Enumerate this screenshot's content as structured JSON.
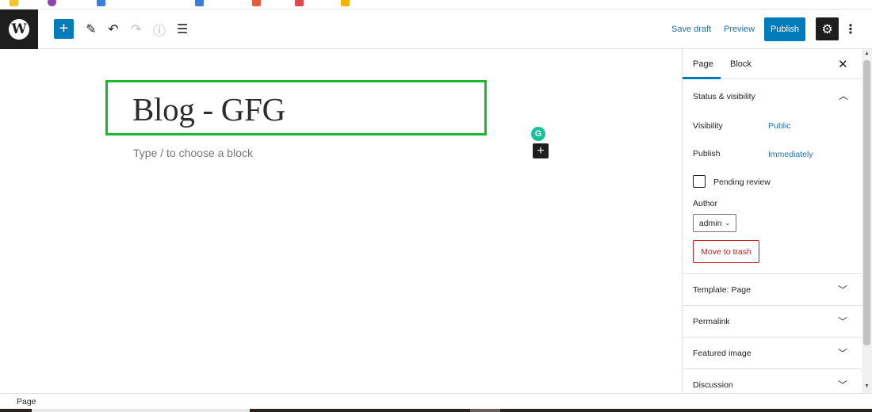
{
  "toolbar": {
    "add_icon": "+",
    "edit_icon": "✎",
    "undo_icon": "↶",
    "redo_icon": "↷",
    "info_icon": "ⓘ",
    "list_icon": "☰",
    "save_draft_label": "Save draft",
    "preview_label": "Preview",
    "publish_label": "Publish",
    "settings_icon": "⚙",
    "more_icon": "⋮",
    "accent_color": "#007cba"
  },
  "editor": {
    "title": "Blog - GFG",
    "placeholder": "Type / to choose a block",
    "inserter_icon": "+",
    "title_highlight_color": "#19b82e"
  },
  "sidebar": {
    "tabs": [
      {
        "label": "Page",
        "active": true
      },
      {
        "label": "Block",
        "active": false
      }
    ],
    "close_icon": "✕",
    "status_visibility": {
      "title": "Status & visibility",
      "expanded": true,
      "visibility_label": "Visibility",
      "visibility_value": "Public",
      "publish_label": "Publish",
      "publish_value": "Immediately",
      "pending_review_label": "Pending review",
      "pending_review_checked": false,
      "author_label": "Author",
      "author_value": "admin",
      "move_to_trash_label": "Move to trash"
    },
    "panels": [
      {
        "title": "Template: Page",
        "expanded": false
      },
      {
        "title": "Permalink",
        "expanded": false
      },
      {
        "title": "Featured image",
        "expanded": false
      },
      {
        "title": "Discussion",
        "expanded": false
      }
    ]
  },
  "footer": {
    "breadcrumb": "Page"
  }
}
